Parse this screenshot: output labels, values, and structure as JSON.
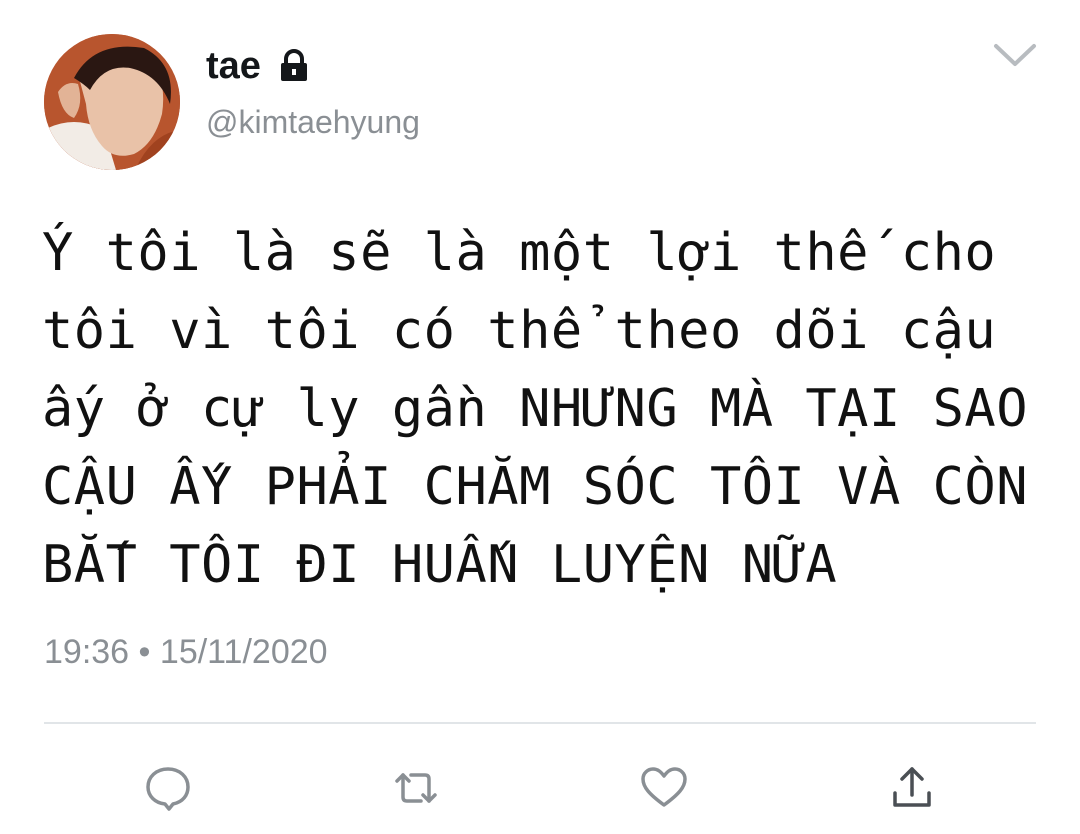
{
  "header": {
    "display_name": "tae",
    "handle": "@kimtaehyung",
    "locked_icon": "lock-icon",
    "menu_icon": "chevron-down-icon"
  },
  "tweet": {
    "lines": [
      "Ý tôi là sẽ là một lợi thế cho",
      "tôi vì tôi có thể theo dõi cậu",
      "ấy ở cự ly gần NHƯNG MÀ TẠI SAO",
      "CẬU ẤY PHẢI CHĂM SÓC TÔI VÀ CÒN",
      "BẮT TÔI ĐI HUẤN LUYỆN NỮA"
    ],
    "time": "19:36",
    "separator": "•",
    "date": "15/11/2020"
  },
  "actions": {
    "icons": [
      "reply-icon",
      "retweet-icon",
      "like-icon",
      "share-icon"
    ]
  },
  "colors": {
    "text": "#14171a",
    "muted": "#8a8f94",
    "divider": "#e1e5e8"
  }
}
